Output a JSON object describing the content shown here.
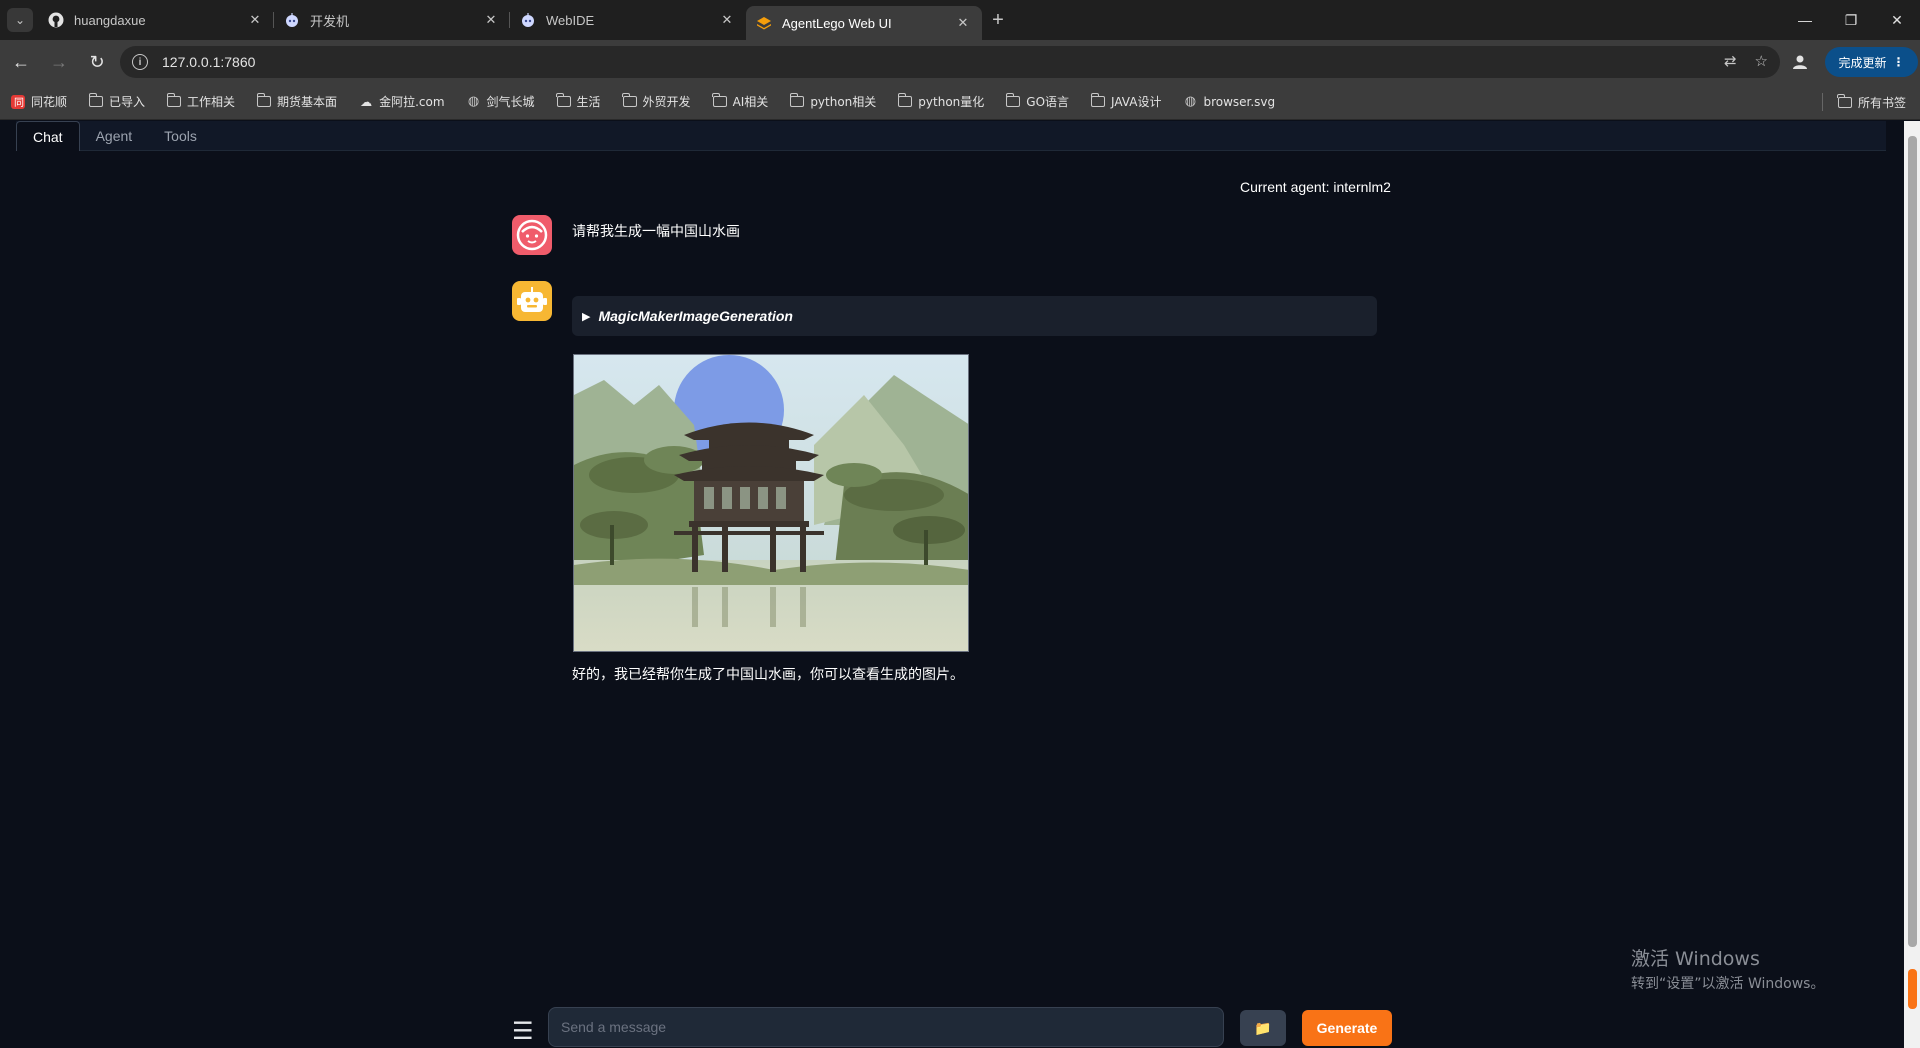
{
  "browser": {
    "tabs": [
      {
        "title": "huangdaxue",
        "icon": "github-icon"
      },
      {
        "title": "开发机",
        "icon": "robot-icon"
      },
      {
        "title": "WebIDE",
        "icon": "robot-icon"
      },
      {
        "title": "AgentLego Web UI",
        "icon": "layers-icon"
      }
    ],
    "active_tab_index": 3,
    "url": "127.0.0.1:7860",
    "update_label": "完成更新",
    "bookmarks": [
      "同花顺",
      "已导入",
      "工作相关",
      "期货基本面",
      "金阿拉.com",
      "剑气长城",
      "生活",
      "外贸开发",
      "AI相关",
      "python相关",
      "python量化",
      "GO语言",
      "JAVA设计",
      "browser.svg"
    ],
    "all_bookmarks_label": "所有书签"
  },
  "app": {
    "tabs": [
      "Chat",
      "Agent",
      "Tools"
    ],
    "active_tab": "Chat",
    "current_agent": "Current agent: internlm2",
    "user_message": "请帮我生成一幅中国山水画",
    "tool_call": "MagicMakerImageGeneration",
    "bot_reply": "好的，我已经帮你生成了中国山水画，你可以查看生成的图片。",
    "input_placeholder": "Send a message",
    "generate_label": "Generate",
    "upload_icon": "📁"
  },
  "os": {
    "watermark_title": "激活 Windows",
    "watermark_sub": "转到“设置”以激活 Windows。"
  },
  "colors": {
    "page_bg": "#0b0f19",
    "accent": "#f97316",
    "user_avatar": "#f05c6b",
    "bot_avatar": "#f7b733"
  }
}
